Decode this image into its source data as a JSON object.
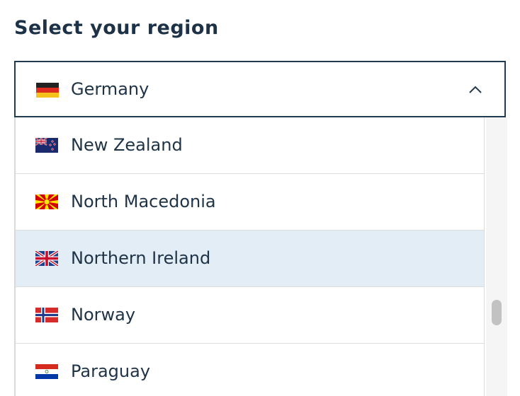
{
  "heading": "Select your region",
  "select": {
    "selected_label": "Germany",
    "selected_flag": "germany-flag-icon"
  },
  "options": [
    {
      "label": "New Zealand",
      "flag": "new-zealand-flag-icon"
    },
    {
      "label": "North Macedonia",
      "flag": "north-macedonia-flag-icon"
    },
    {
      "label": "Northern Ireland",
      "flag": "uk-flag-icon",
      "highlighted": true
    },
    {
      "label": "Norway",
      "flag": "norway-flag-icon"
    },
    {
      "label": "Paraguay",
      "flag": "paraguay-flag-icon"
    }
  ],
  "colors": {
    "text": "#1f3347",
    "border": "#213a50",
    "highlight": "#e2edf6"
  }
}
